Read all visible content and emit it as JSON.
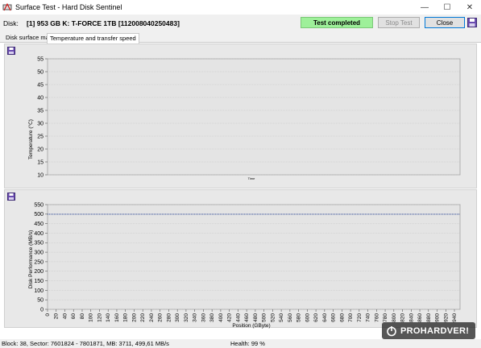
{
  "window": {
    "title": "Surface Test - Hard Disk Sentinel",
    "minimize_glyph": "—",
    "maximize_glyph": "☐",
    "close_glyph": "✕"
  },
  "toolbar": {
    "disk_label": "Disk:",
    "disk_value": "[1] 953 GB K: T-FORCE 1TB [112008040250483]",
    "status": "Test completed",
    "stop_button": "Stop Test",
    "close_button": "Close"
  },
  "tabs": [
    {
      "label": "Disk surface map",
      "active": false
    },
    {
      "label": "Temperature and transfer speed",
      "active": true
    }
  ],
  "chart_data": [
    {
      "type": "line",
      "ylabel": "Temperature (°C)",
      "xlabel": "Time",
      "ylim": [
        10,
        55
      ],
      "yticks": [
        "55",
        "50",
        "45",
        "40",
        "35",
        "30",
        "25",
        "20",
        "15",
        "10"
      ],
      "series": [],
      "grid": true
    },
    {
      "type": "line",
      "ylabel": "Disk Performance (MB/s)",
      "xlabel": "Position (GByte)",
      "ylim": [
        0,
        550
      ],
      "xlim": [
        0,
        953
      ],
      "yticks": [
        "550",
        "500",
        "450",
        "400",
        "350",
        "300",
        "250",
        "200",
        "150",
        "100",
        "50",
        "0"
      ],
      "xticks": [
        "0",
        "20",
        "40",
        "60",
        "80",
        "100",
        "120",
        "140",
        "160",
        "180",
        "200",
        "220",
        "240",
        "260",
        "280",
        "300",
        "320",
        "340",
        "360",
        "380",
        "400",
        "420",
        "440",
        "460",
        "480",
        "500",
        "520",
        "540",
        "560",
        "580",
        "600",
        "620",
        "640",
        "660",
        "680",
        "700",
        "720",
        "740",
        "760",
        "780",
        "800",
        "820",
        "840",
        "860",
        "880",
        "900",
        "920",
        "940"
      ],
      "series": [
        {
          "x": [
            0,
            953
          ],
          "y": [
            499.61,
            499.61
          ]
        }
      ],
      "grid": true
    }
  ],
  "statusbar": {
    "left": "Block: 38, Sector: 7601824 - 7801871, MB: 3711, 499,61 MB/s",
    "health": "Health: 99 %"
  },
  "watermark": {
    "text": "PROHARDVER!"
  },
  "colors": {
    "status_bg": "#9ef09a",
    "panel_bg": "#e8e8e8",
    "series_color": "#1f3b8f"
  }
}
